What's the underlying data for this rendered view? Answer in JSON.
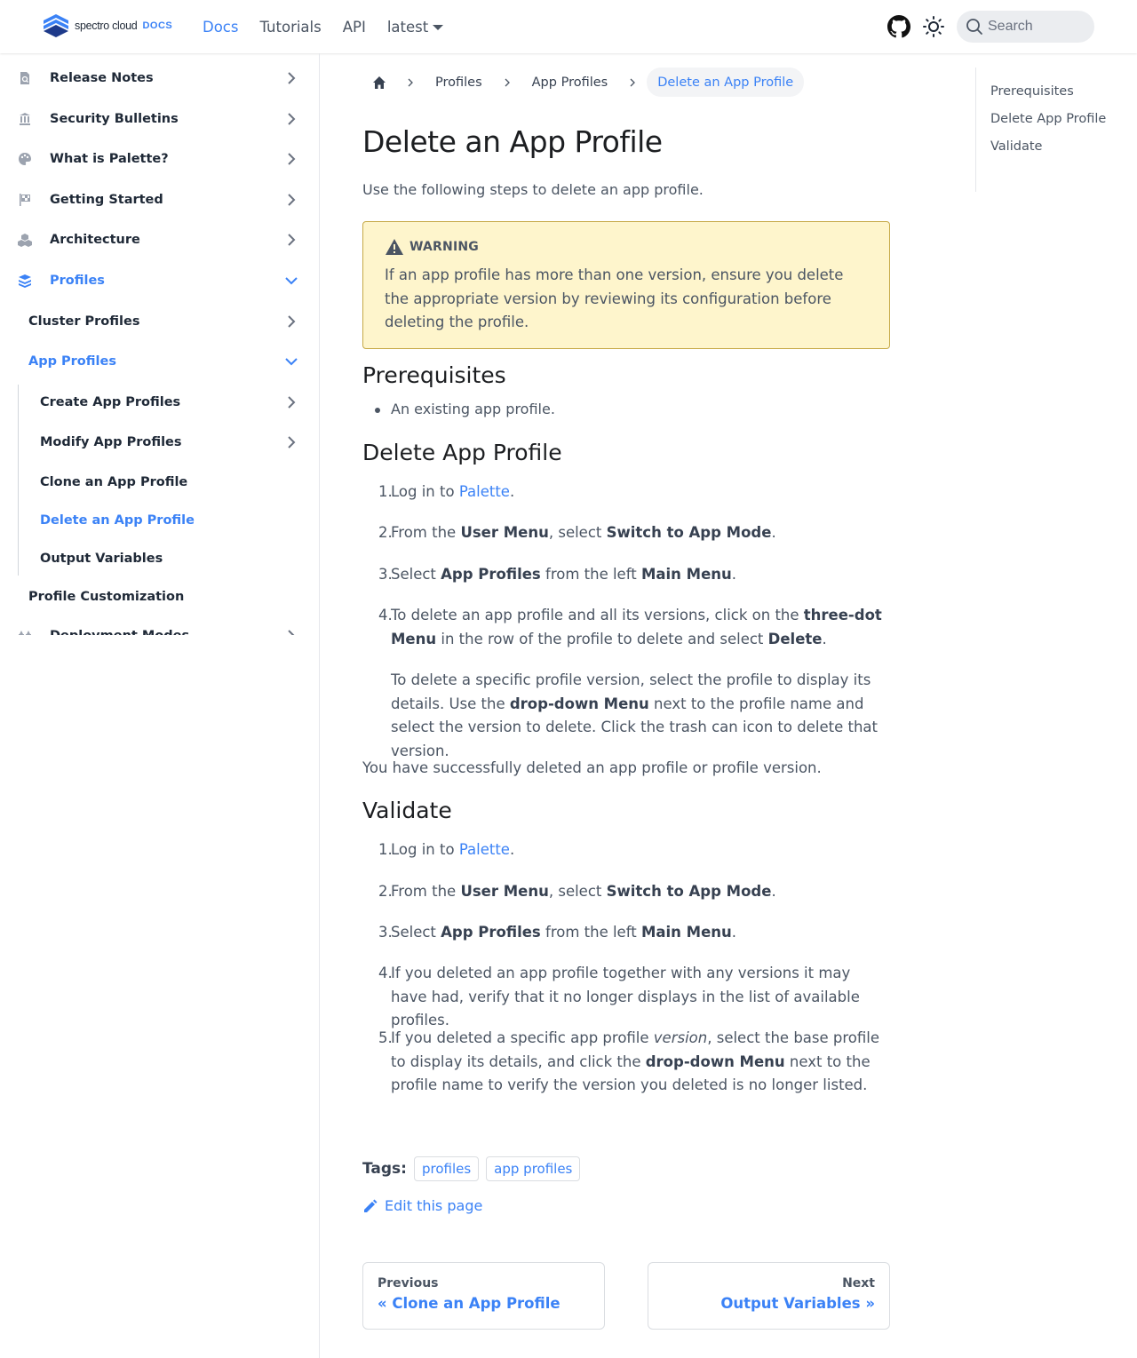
{
  "navbar": {
    "logo_text": "spectro cloud",
    "logo_docs": "DOCS",
    "links": [
      "Docs",
      "Tutorials",
      "API"
    ],
    "version": "latest",
    "search_placeholder": "Search"
  },
  "sidebar": {
    "items": [
      {
        "label": "Release Notes",
        "icon": "search-doc-icon"
      },
      {
        "label": "Security Bulletins",
        "icon": "building-icon"
      },
      {
        "label": "What is Palette?",
        "icon": "palette-icon"
      },
      {
        "label": "Getting Started",
        "icon": "flag-icon"
      },
      {
        "label": "Architecture",
        "icon": "cubes-icon"
      },
      {
        "label": "Profiles",
        "icon": "layers-icon"
      },
      {
        "label": "Cluster Profiles"
      },
      {
        "label": "App Profiles"
      },
      {
        "label": "Create App Profiles"
      },
      {
        "label": "Modify App Profiles"
      },
      {
        "label": "Clone an App Profile"
      },
      {
        "label": "Delete an App Profile"
      },
      {
        "label": "Output Variables"
      },
      {
        "label": "Profile Customization"
      },
      {
        "label": "Deployment Modes",
        "icon": "deploy-icon"
      }
    ]
  },
  "breadcrumb": [
    "Profiles",
    "App Profiles",
    "Delete an App Profile"
  ],
  "page": {
    "title": "Delete an App Profile",
    "intro": "Use the following steps to delete an app profile.",
    "warning_title": "WARNING",
    "warning_body": "If an app profile has more than one version, ensure you delete the appropriate version by reviewing its configuration before deleting the profile.",
    "prereq_heading": "Prerequisites",
    "prereq_item": "An existing app profile.",
    "delete_heading": "Delete App Profile",
    "validate_heading": "Validate",
    "success_text": "You have successfully deleted an app profile or profile version.",
    "step4_extra": "To delete a specific profile version, select the profile to display its details. Use the drop-down Menu next to the profile name and select the version to delete. Click the trash can icon to delete that version."
  },
  "tags": {
    "label": "Tags:",
    "items": [
      "profiles",
      "app profiles"
    ]
  },
  "edit_label": "Edit this page",
  "pager": {
    "prev_sub": "Previous",
    "prev_label": "« Clone an App Profile",
    "next_sub": "Next",
    "next_label": "Output Variables »"
  },
  "toc": [
    "Prerequisites",
    "Delete App Profile",
    "Validate"
  ],
  "colors": {
    "accent": "#3b82f6",
    "warning_bg": "#fef5cc",
    "warning_border": "#c6a947"
  }
}
